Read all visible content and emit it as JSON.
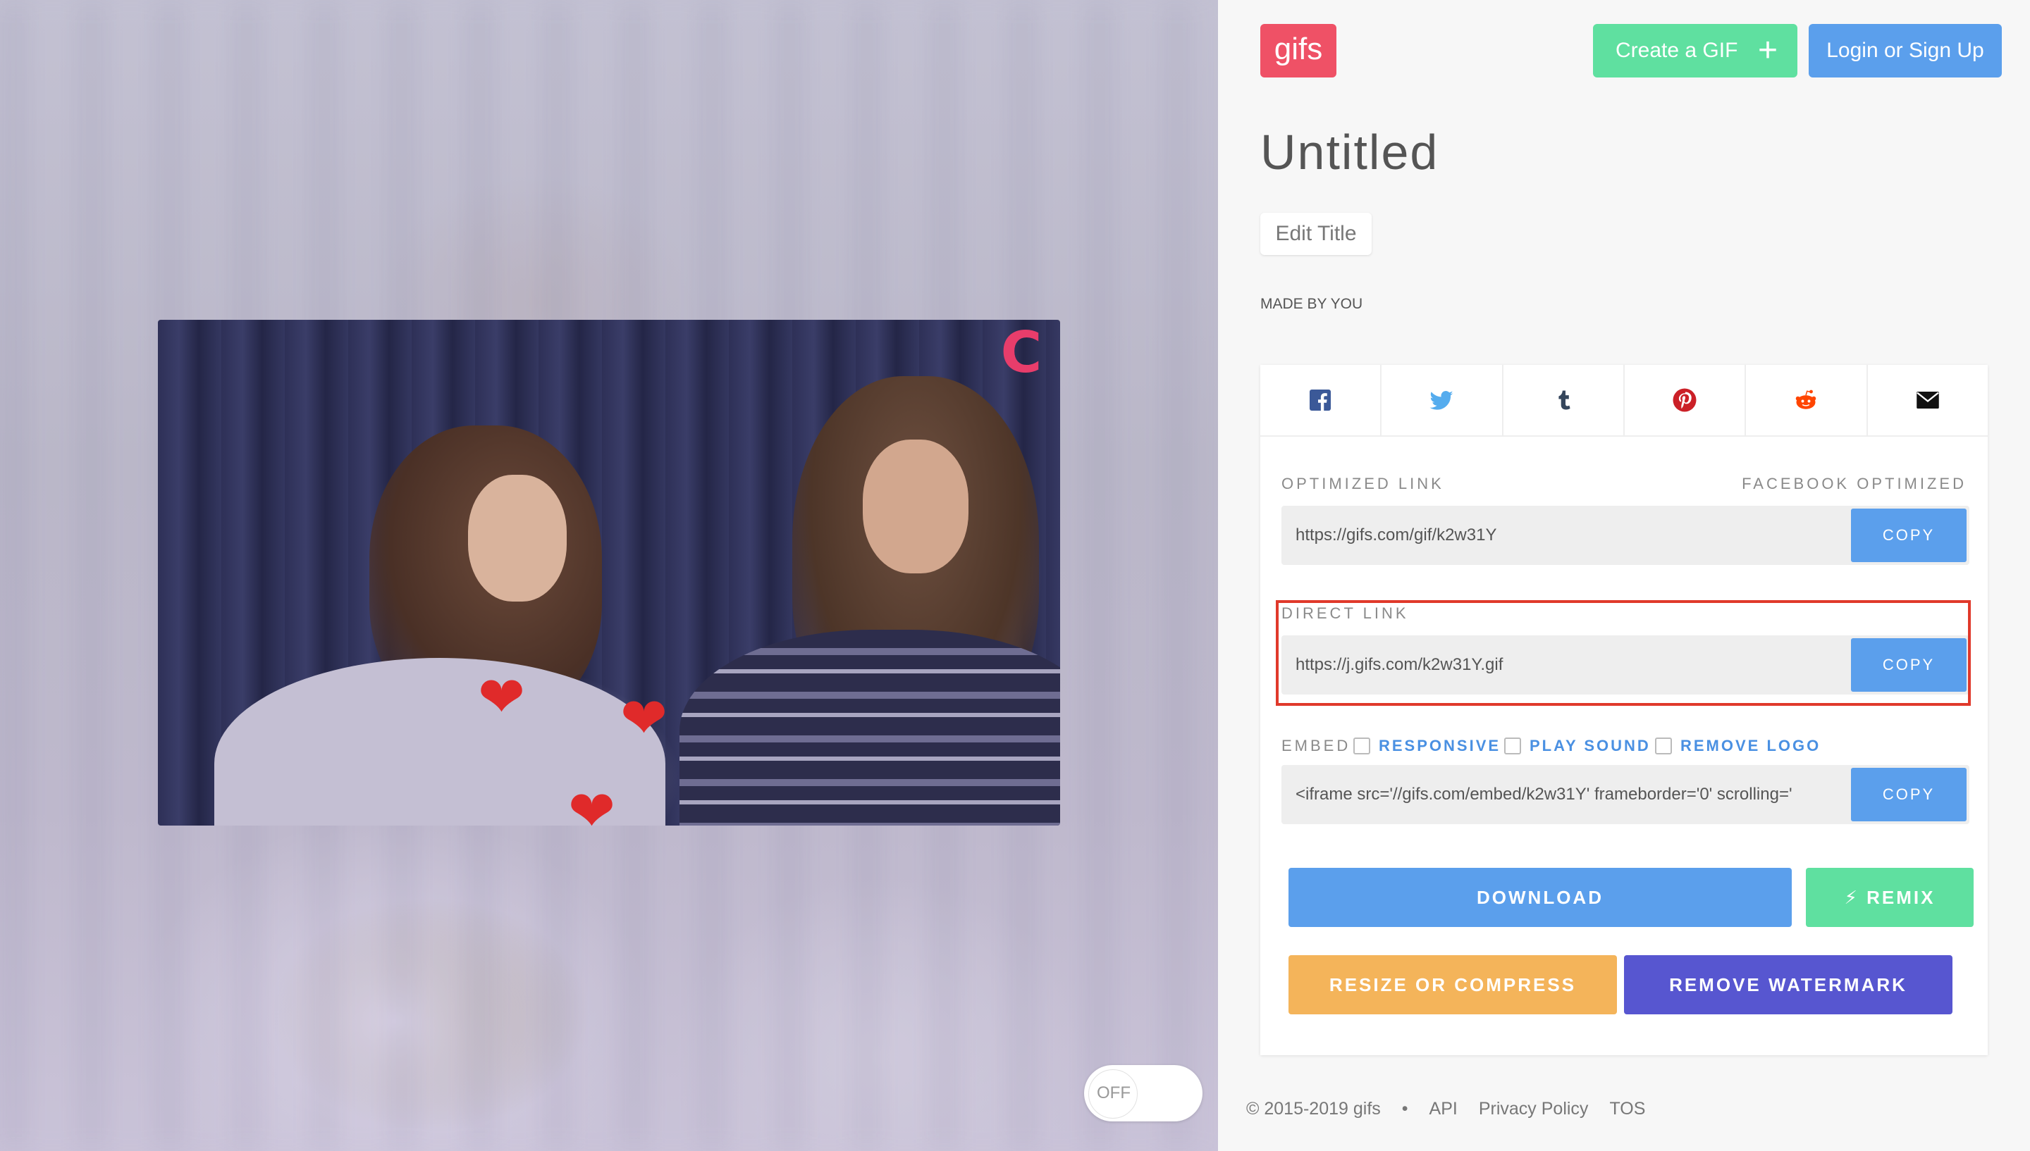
{
  "brand": {
    "logo_text": "gifs"
  },
  "header": {
    "create_label": "Create a GIF",
    "create_icon": "plus-icon",
    "login_label": "Login or Sign Up"
  },
  "gif": {
    "title": "Untitled",
    "edit_title_label": "Edit Title",
    "made_by": "MADE BY YOU"
  },
  "share": {
    "icons": [
      "facebook-icon",
      "twitter-icon",
      "tumblr-icon",
      "pinterest-icon",
      "reddit-icon",
      "email-icon"
    ]
  },
  "links": {
    "optimized_label": "OPTIMIZED LINK",
    "facebook_optimized": "FACEBOOK OPTIMIZED",
    "optimized_url": "https://gifs.com/gif/k2w31Y",
    "direct_label": "DIRECT LINK",
    "direct_url": "https://j.gifs.com/k2w31Y.gif",
    "embed_label": "EMBED",
    "embed_options": [
      "RESPONSIVE",
      "PLAY SOUND",
      "REMOVE LOGO"
    ],
    "embed_code": "<iframe src='//gifs.com/embed/k2w31Y' frameborder='0' scrolling='",
    "copy_label": "COPY"
  },
  "actions": {
    "download_label": "DOWNLOAD",
    "remix_label": "REMIX",
    "resize_label": "RESIZE OR COMPRESS",
    "watermark_label": "REMOVE WATERMARK"
  },
  "preview": {
    "toggle_label": "OFF"
  },
  "footer": {
    "copyright": "© 2015-2019 gifs",
    "separator": "•",
    "links": [
      "API",
      "Privacy Policy",
      "TOS"
    ]
  },
  "colors": {
    "brand": "#ef5166",
    "create": "#5fe0a0",
    "primary": "#5b9fec",
    "resize": "#f4b45a",
    "watermark": "#5756d0",
    "highlight": "#e0392b"
  }
}
